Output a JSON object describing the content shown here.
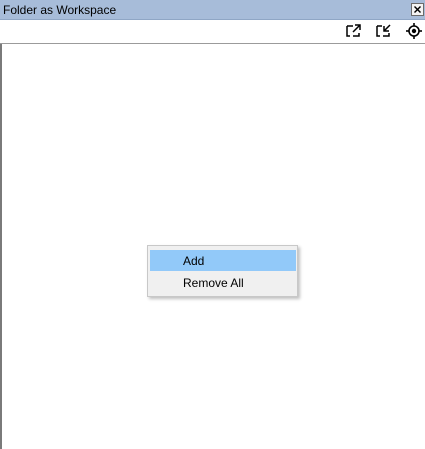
{
  "window": {
    "title": "Folder as Workspace",
    "close_icon": "close-icon"
  },
  "toolbar": {
    "buttons": [
      {
        "name": "expand-all-icon"
      },
      {
        "name": "collapse-all-icon"
      },
      {
        "name": "locate-current-file-icon"
      }
    ]
  },
  "context_menu": {
    "items": [
      {
        "label": "Add",
        "highlighted": true
      },
      {
        "label": "Remove All",
        "highlighted": false
      }
    ]
  },
  "colors": {
    "titlebar": "#a7bcd9",
    "menu_highlight": "#92c9f9",
    "menu_background": "#f0f0f0"
  }
}
